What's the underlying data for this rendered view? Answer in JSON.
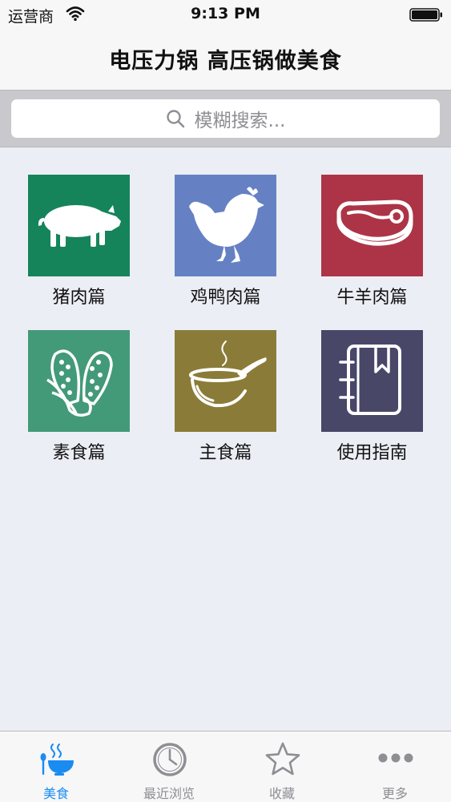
{
  "status_bar": {
    "carrier": "运营商",
    "time": "9:13 PM"
  },
  "nav": {
    "title": "电压力锅 高压锅做美食"
  },
  "search": {
    "placeholder": "模糊搜索..."
  },
  "categories": [
    {
      "label": "猪肉篇",
      "icon": "pig-icon",
      "color": "#15845a"
    },
    {
      "label": "鸡鸭肉篇",
      "icon": "chicken-icon",
      "color": "#6581c4"
    },
    {
      "label": "牛羊肉篇",
      "icon": "steak-icon",
      "color": "#ad3446"
    },
    {
      "label": "素食篇",
      "icon": "corn-icon",
      "color": "#439a78"
    },
    {
      "label": "主食篇",
      "icon": "bowl-icon",
      "color": "#8a7c38"
    },
    {
      "label": "使用指南",
      "icon": "notebook-icon",
      "color": "#484768"
    }
  ],
  "tab_bar": {
    "tabs": [
      {
        "label": "美食",
        "icon": "bowl-spoon-icon",
        "active": true
      },
      {
        "label": "最近浏览",
        "icon": "clock-icon",
        "active": false
      },
      {
        "label": "收藏",
        "icon": "star-icon",
        "active": false
      },
      {
        "label": "更多",
        "icon": "more-dots-icon",
        "active": false
      }
    ]
  },
  "colors": {
    "accent": "#1a8cf0",
    "inactive": "#8e8e93"
  }
}
